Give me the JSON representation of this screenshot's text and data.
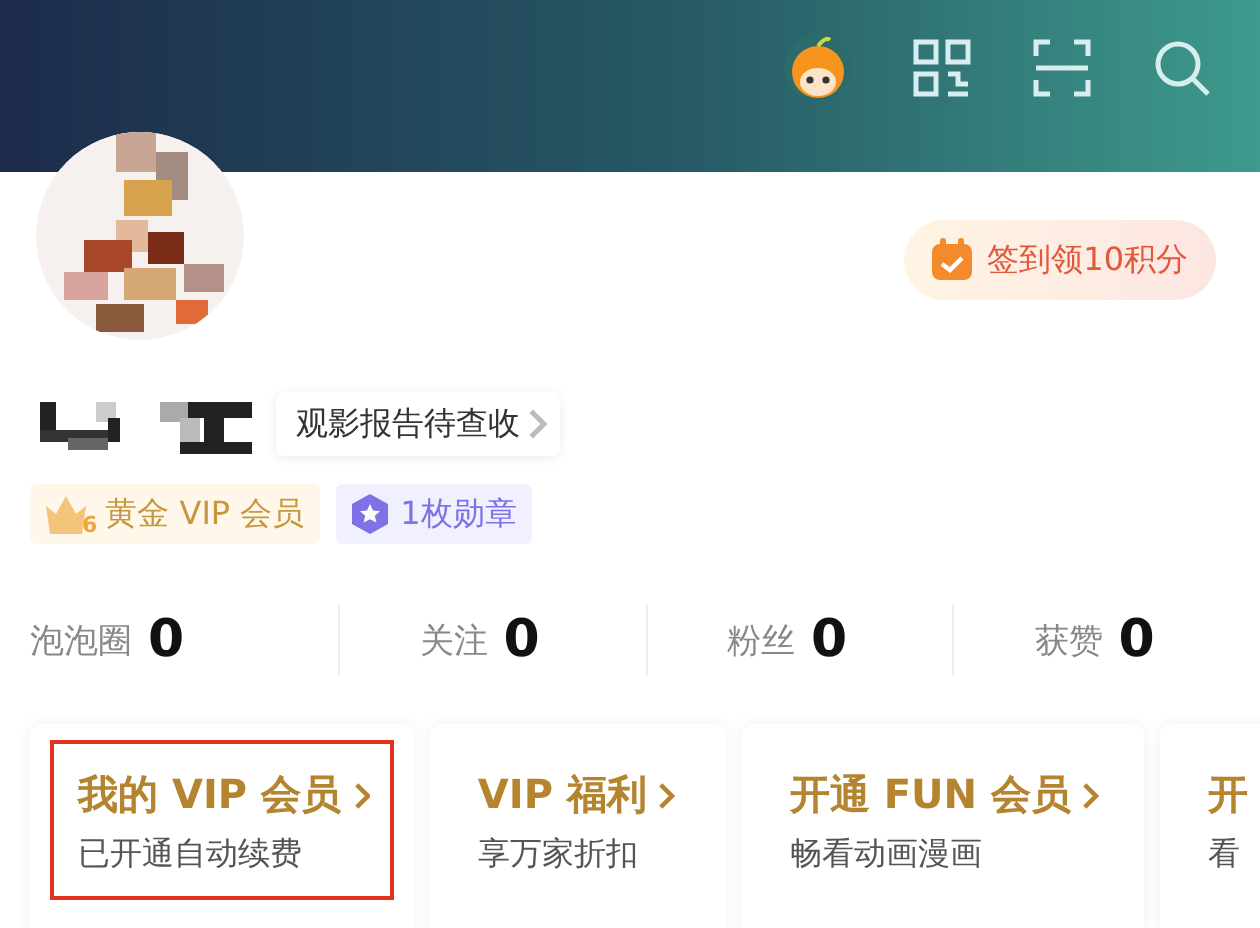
{
  "checkin": {
    "label": "签到领10积分"
  },
  "report_chip": {
    "label": "观影报告待查收"
  },
  "badges": [
    {
      "kind": "vip",
      "level_number": "6",
      "label": "黄金 VIP 会员"
    },
    {
      "kind": "medal",
      "label": "1枚勋章"
    }
  ],
  "stats": [
    {
      "label": "泡泡圈",
      "value": "0"
    },
    {
      "label": "关注",
      "value": "0"
    },
    {
      "label": "粉丝",
      "value": "0"
    },
    {
      "label": "获赞",
      "value": "0"
    }
  ],
  "cards": [
    {
      "title": "我的 VIP 会员",
      "subtitle": "已开通自动续费",
      "highlighted": true
    },
    {
      "title": "VIP 福利",
      "subtitle": "享万家折扣",
      "highlighted": false
    },
    {
      "title": "开通 FUN 会员",
      "subtitle": "畅看动画漫画",
      "highlighted": false
    },
    {
      "title": "开",
      "subtitle": "看",
      "highlighted": false
    }
  ]
}
